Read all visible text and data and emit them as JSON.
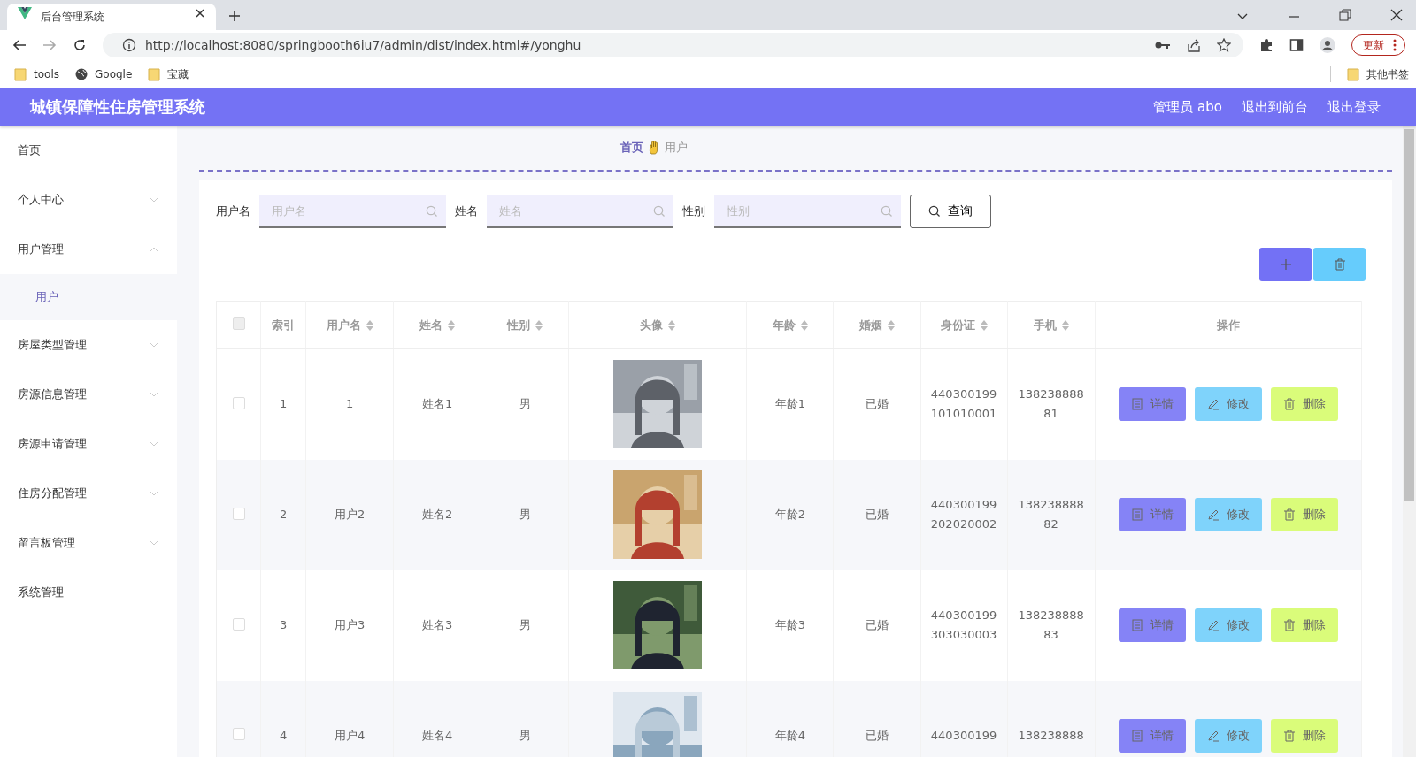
{
  "browser": {
    "tab_title": "后台管理系统",
    "url": "http://localhost:8080/springbooth6iu7/admin/dist/index.html#/yonghu",
    "bookmarks": [
      "tools",
      "Google",
      "宝藏"
    ],
    "other_bookmarks": "其他书签",
    "update_button": "更新"
  },
  "header": {
    "title": "城镇保障性住房管理系统",
    "user": "管理员 abo",
    "links": [
      "退出到前台",
      "退出登录"
    ]
  },
  "sidebar": {
    "items": [
      {
        "label": "首页",
        "kind": "link"
      },
      {
        "label": "个人中心",
        "kind": "menu",
        "expanded": false
      },
      {
        "label": "用户管理",
        "kind": "menu",
        "expanded": true,
        "children": [
          {
            "label": "用户",
            "selected": true
          }
        ]
      },
      {
        "label": "房屋类型管理",
        "kind": "menu",
        "expanded": false
      },
      {
        "label": "房源信息管理",
        "kind": "menu",
        "expanded": false
      },
      {
        "label": "房源申请管理",
        "kind": "menu",
        "expanded": false
      },
      {
        "label": "住房分配管理",
        "kind": "menu",
        "expanded": false
      },
      {
        "label": "留言板管理",
        "kind": "menu",
        "expanded": false
      },
      {
        "label": "系统管理",
        "kind": "link"
      }
    ]
  },
  "breadcrumb": [
    "首页",
    "用户"
  ],
  "search": {
    "fields": [
      {
        "label": "用户名",
        "placeholder": "用户名"
      },
      {
        "label": "姓名",
        "placeholder": "姓名"
      },
      {
        "label": "性别",
        "placeholder": "性别"
      }
    ],
    "button": "查询"
  },
  "table": {
    "header_checked": false,
    "columns": [
      {
        "label": "索引",
        "sortable": false
      },
      {
        "label": "用户名",
        "sortable": true
      },
      {
        "label": "姓名",
        "sortable": true
      },
      {
        "label": "性别",
        "sortable": true
      },
      {
        "label": "头像",
        "sortable": true
      },
      {
        "label": "年龄",
        "sortable": true
      },
      {
        "label": "婚姻",
        "sortable": true
      },
      {
        "label": "身份证",
        "sortable": true
      },
      {
        "label": "手机",
        "sortable": true
      },
      {
        "label": "操作",
        "sortable": false
      }
    ],
    "rows": [
      {
        "checked": false,
        "index": "1",
        "username": "1",
        "name": "姓名1",
        "gender": "男",
        "age": "年龄1",
        "marriage": "已婚",
        "id_card": "440300199101010001",
        "phone": "13823888881",
        "actions": [
          "详情",
          "修改",
          "删除"
        ]
      },
      {
        "checked": false,
        "index": "2",
        "username": "用户2",
        "name": "姓名2",
        "gender": "男",
        "age": "年龄2",
        "marriage": "已婚",
        "id_card": "440300199202020002",
        "phone": "13823888882",
        "actions": [
          "详情",
          "修改",
          "删除"
        ]
      },
      {
        "checked": false,
        "index": "3",
        "username": "用户3",
        "name": "姓名3",
        "gender": "男",
        "age": "年龄3",
        "marriage": "已婚",
        "id_card": "440300199303030003",
        "phone": "13823888883",
        "actions": [
          "详情",
          "修改",
          "删除"
        ]
      },
      {
        "checked": false,
        "index": "4",
        "username": "用户4",
        "name": "姓名4",
        "gender": "男",
        "age": "年龄4",
        "marriage": "已婚",
        "id_card": "440300199",
        "phone": "138238888",
        "actions": [
          "详情",
          "修改",
          "删除"
        ]
      }
    ]
  }
}
